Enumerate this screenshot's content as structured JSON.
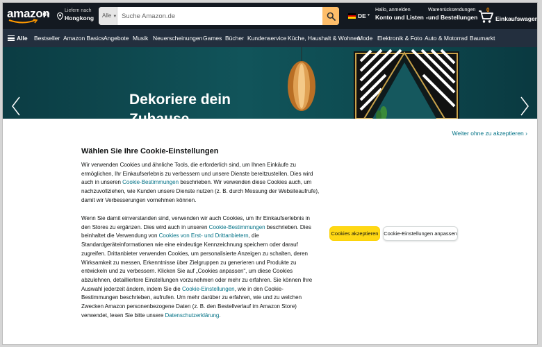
{
  "colors": {
    "nav_dark": "#131921",
    "nav_sub": "#232f3e",
    "search_button": "#febd69",
    "accept_button": "#ffd814",
    "link": "#007185",
    "cart_count": "#f08804"
  },
  "header": {
    "logo_text": "amazon",
    "logo_tld": ".de",
    "deliver_line1": "Liefern nach",
    "deliver_line2": "Hongkong",
    "search": {
      "category": "Alle",
      "placeholder": "Suche Amazon.de",
      "button_icon": "search-icon"
    },
    "language": "DE",
    "account_line1": "Hallo, anmelden",
    "account_line2": "Konto und Listen",
    "returns_line1": "Warenrücksendungen",
    "returns_line2": "und Bestellungen",
    "cart_count": "0",
    "cart_label": "Einkaufswagen"
  },
  "subnav": {
    "all_label": "Alle",
    "items": [
      "Bestseller",
      "Amazon Basics",
      "Angebote",
      "Musik",
      "Neuerscheinungen",
      "Games",
      "Bücher",
      "Kundenservice",
      "Küche, Haushalt & Wohnen",
      "Mode",
      "Elektronik & Foto",
      "Auto & Motorrad",
      "Baumarkt"
    ]
  },
  "hero": {
    "headline_line1": "Dekoriere dein",
    "headline_line2": "Zuhause"
  },
  "cookie_dialog": {
    "skip_link": "Weiter ohne zu akzeptieren",
    "title": "Wählen Sie Ihre Cookie-Einstellungen",
    "p1_a": "Wir verwenden Cookies und ähnliche Tools, die erforderlich sind, um Ihnen Einkäufe zu ermöglichen, Ihr Einkaufserlebnis zu verbessern und unsere Dienste bereitzustellen. Dies wird auch in unseren ",
    "p1_link": "Cookie-Bestimmungen",
    "p1_b": " beschrieben. Wir verwenden diese Cookies auch, um nachzuvollziehen, wie Kunden unsere Dienste nutzen (z. B. durch Messung der Websiteaufrufe), damit wir Verbesserungen vornehmen können.",
    "p2_a": "Wenn Sie damit einverstanden sind, verwenden wir auch Cookies, um Ihr Einkaufserlebnis in den Stores zu ergänzen. Dies wird auch in unseren ",
    "p2_link1": "Cookie-Bestimmungen",
    "p2_b": " beschrieben. Dies beinhaltet die Verwendung von ",
    "p2_link2": "Cookies von Erst- und Drittanbietern",
    "p2_c": ", die Standardgeräteinformationen wie eine eindeutige Kennzeichnung speichern oder darauf zugreifen. Drittanbieter verwenden Cookies, um personalisierte Anzeigen zu schalten, deren Wirksamkeit zu messen, Erkenntnisse über Zielgruppen zu generieren und Produkte zu entwickeln und zu verbessern. Klicken Sie auf „Cookies anpassen“, um diese Cookies abzulehnen, detailliertere Einstellungen vorzunehmen oder mehr zu erfahren. Sie können Ihre Auswahl jederzeit ändern, indem Sie die ",
    "p2_link3": "Cookie-Einstellungen",
    "p2_d": ", wie in den Cookie-Bestimmungen beschrieben, aufrufen. Um mehr darüber zu erfahren, wie und zu welchen Zwecken Amazon personenbezogene Daten (z. B. den Bestellverlauf im Amazon Store) verwendet, lesen Sie bitte unsere ",
    "p2_link4": "Datenschutzerklärung",
    "p2_e": ".",
    "accept_label": "Cookies akzeptieren",
    "customize_label": "Cookie-Einstellungen anpassen"
  }
}
